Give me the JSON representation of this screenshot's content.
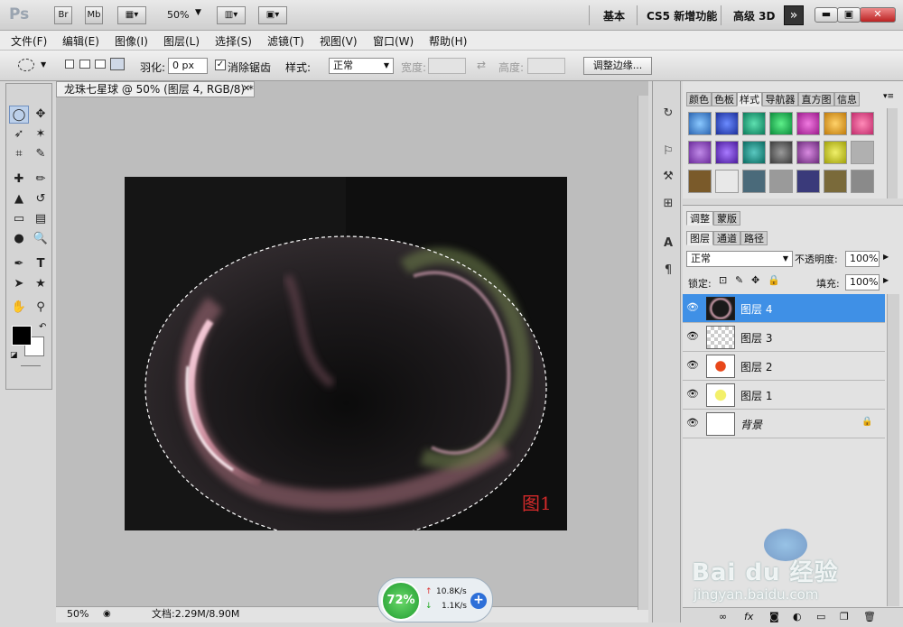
{
  "app": {
    "logo": "Ps",
    "btn_br": "Br",
    "btn_mb": "Mb",
    "zoom": "50%",
    "ws_basic": "基本",
    "ws_new": "CS5 新增功能",
    "ws_3d": "高级 3D",
    "more": "»",
    "win_min": "▬",
    "win_max": "▣",
    "win_close": "✕"
  },
  "menu": [
    "文件(F)",
    "编辑(E)",
    "图像(I)",
    "图层(L)",
    "选择(S)",
    "滤镜(T)",
    "视图(V)",
    "窗口(W)",
    "帮助(H)"
  ],
  "options": {
    "feather_label": "羽化:",
    "feather_value": "0 px",
    "antialias_label": "消除锯齿",
    "style_label": "样式:",
    "style_value": "正常",
    "width_label": "宽度:",
    "height_label": "高度:",
    "refine_button": "调整边缘..."
  },
  "document": {
    "tab_title": "龙珠七星球 @ 50% (图层 4, RGB/8) *",
    "tab_close": "✕",
    "canvas_label": "图1",
    "status_zoom": "50%",
    "status_doc": "文档:2.29M/8.90M"
  },
  "overlay": {
    "percent": "72%",
    "up_speed": "10.8K/s",
    "down_speed": "1.1K/s"
  },
  "panels": {
    "tabs_top": [
      "颜色",
      "色板",
      "样式",
      "导航器",
      "直方图",
      "信息"
    ],
    "tabs_mid": [
      "调整",
      "蒙版"
    ],
    "tabs_layers": [
      "图层",
      "通道",
      "路径"
    ],
    "blend_mode": "正常",
    "opacity_label": "不透明度:",
    "opacity_value": "100%",
    "lock_label": "锁定:",
    "fill_label": "填充:",
    "fill_value": "100%"
  },
  "layers": [
    {
      "name": "图层 4",
      "selected": true
    },
    {
      "name": "图层 3",
      "selected": false
    },
    {
      "name": "图层 2",
      "selected": false
    },
    {
      "name": "图层 1",
      "selected": false
    },
    {
      "name": "背景",
      "selected": false
    }
  ],
  "watermark": {
    "brand": "Bai du 经验",
    "url": "jingyan.baidu.com"
  },
  "colors": {
    "selected_layer": "#3f90e6",
    "canvas_bg": "#141414",
    "label_red": "#d42a2a"
  }
}
